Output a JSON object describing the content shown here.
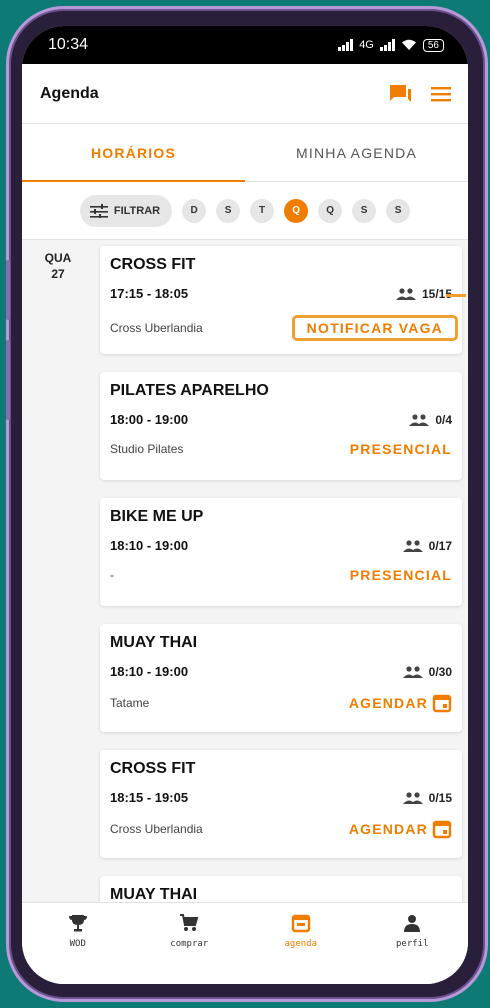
{
  "status": {
    "time": "10:34",
    "network": "4G",
    "battery": "56"
  },
  "header": {
    "title": "Agenda",
    "chat_icon": "chat-icon",
    "menu_icon": "hamburger-menu-icon"
  },
  "tabs": [
    {
      "label": "HORÁRIOS",
      "active": true
    },
    {
      "label": "MINHA AGENDA",
      "active": false
    }
  ],
  "filter": {
    "label": "FILTRAR",
    "days": [
      "D",
      "S",
      "T",
      "Q",
      "Q",
      "S",
      "S"
    ],
    "active_day_index": 3
  },
  "date": {
    "weekday": "QUA",
    "day": "27"
  },
  "classes": [
    {
      "title": "CROSS FIT",
      "time": "17:15 - 18:05",
      "capacity": "15/15",
      "place": "Cross Uberlandia",
      "action": "NOTIFICAR VAGA"
    },
    {
      "title": "PILATES APARELHO",
      "time": "18:00 - 19:00",
      "capacity": "0/4",
      "place": "Studio Pilates",
      "action": "PRESENCIAL"
    },
    {
      "title": "BIKE ME UP",
      "time": "18:10 - 19:00",
      "capacity": "0/17",
      "place": "-",
      "action": "PRESENCIAL"
    },
    {
      "title": "MUAY THAI",
      "time": "18:10 - 19:00",
      "capacity": "0/30",
      "place": "Tatame",
      "action": "AGENDAR"
    },
    {
      "title": "CROSS FIT",
      "time": "18:15 - 19:05",
      "capacity": "0/15",
      "place": "Cross Uberlandia",
      "action": "AGENDAR"
    },
    {
      "title": "MUAY THAI"
    }
  ],
  "nav": [
    {
      "label": "WOD",
      "icon": "trophy-icon"
    },
    {
      "label": "comprar",
      "icon": "cart-icon"
    },
    {
      "label": "agenda",
      "icon": "calendar-icon",
      "active": true
    },
    {
      "label": "perfil",
      "icon": "person-icon"
    }
  ],
  "colors": {
    "accent": "#f07c00",
    "background": "#0e7a75"
  }
}
